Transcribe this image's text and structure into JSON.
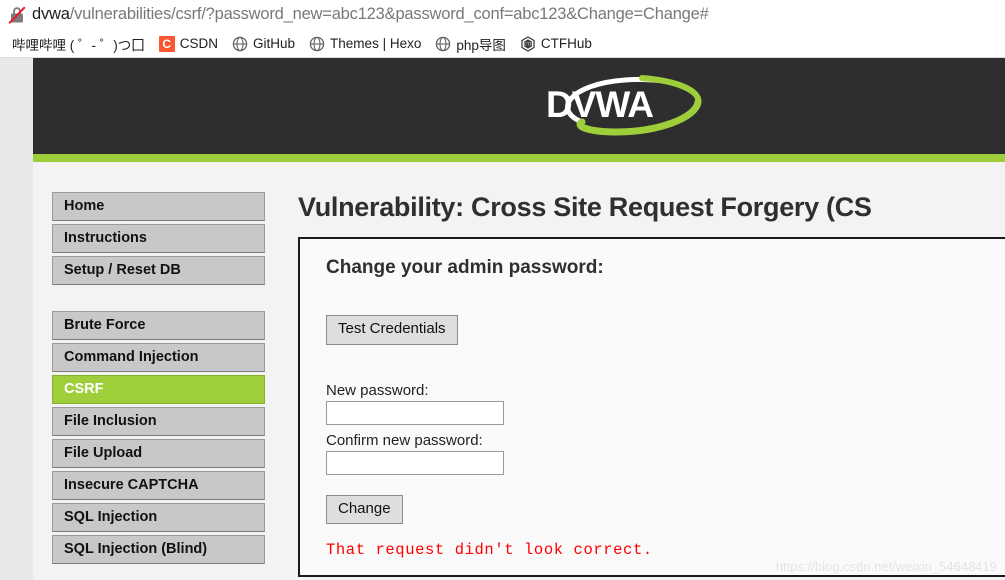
{
  "browser": {
    "security_icon": "insecure-lock-icon",
    "url_host": "dvwa",
    "url_path": "/vulnerabilities/csrf/?password_new=abc123&password_conf=abc123&Change=Change#",
    "bookmarks": [
      {
        "label": "哔哩哔哩 ( ゜- ゜)つ囗",
        "icon": "none"
      },
      {
        "label": "CSDN",
        "icon": "csdn-icon"
      },
      {
        "label": "GitHub",
        "icon": "globe-icon"
      },
      {
        "label": "Themes | Hexo",
        "icon": "globe-icon"
      },
      {
        "label": "php导图",
        "icon": "globe-icon"
      },
      {
        "label": "CTFHub",
        "icon": "ctfhub-hex-icon"
      }
    ]
  },
  "site": {
    "logo_text": "DVWA",
    "header_bg": "#2e2e2e",
    "accent_green": "#9fce3b"
  },
  "sidebar": {
    "items": [
      {
        "label": "Home",
        "active": false
      },
      {
        "label": "Instructions",
        "active": false
      },
      {
        "label": "Setup / Reset DB",
        "active": false
      },
      {
        "label": "Brute Force",
        "active": false
      },
      {
        "label": "Command Injection",
        "active": false
      },
      {
        "label": "CSRF",
        "active": true
      },
      {
        "label": "File Inclusion",
        "active": false
      },
      {
        "label": "File Upload",
        "active": false
      },
      {
        "label": "Insecure CAPTCHA",
        "active": false
      },
      {
        "label": "SQL Injection",
        "active": false
      },
      {
        "label": "SQL Injection (Blind)",
        "active": false
      }
    ]
  },
  "main": {
    "page_title": "Vulnerability: Cross Site Request Forgery (CS",
    "panel_heading": "Change your admin password:",
    "test_credentials_label": "Test Credentials",
    "new_password_label": "New password:",
    "new_password_value": "",
    "confirm_password_label": "Confirm new password:",
    "confirm_password_value": "",
    "change_button_label": "Change",
    "error_message": "That request didn't look correct."
  },
  "watermark": "https://blog.csdn.net/weixin_54648419"
}
